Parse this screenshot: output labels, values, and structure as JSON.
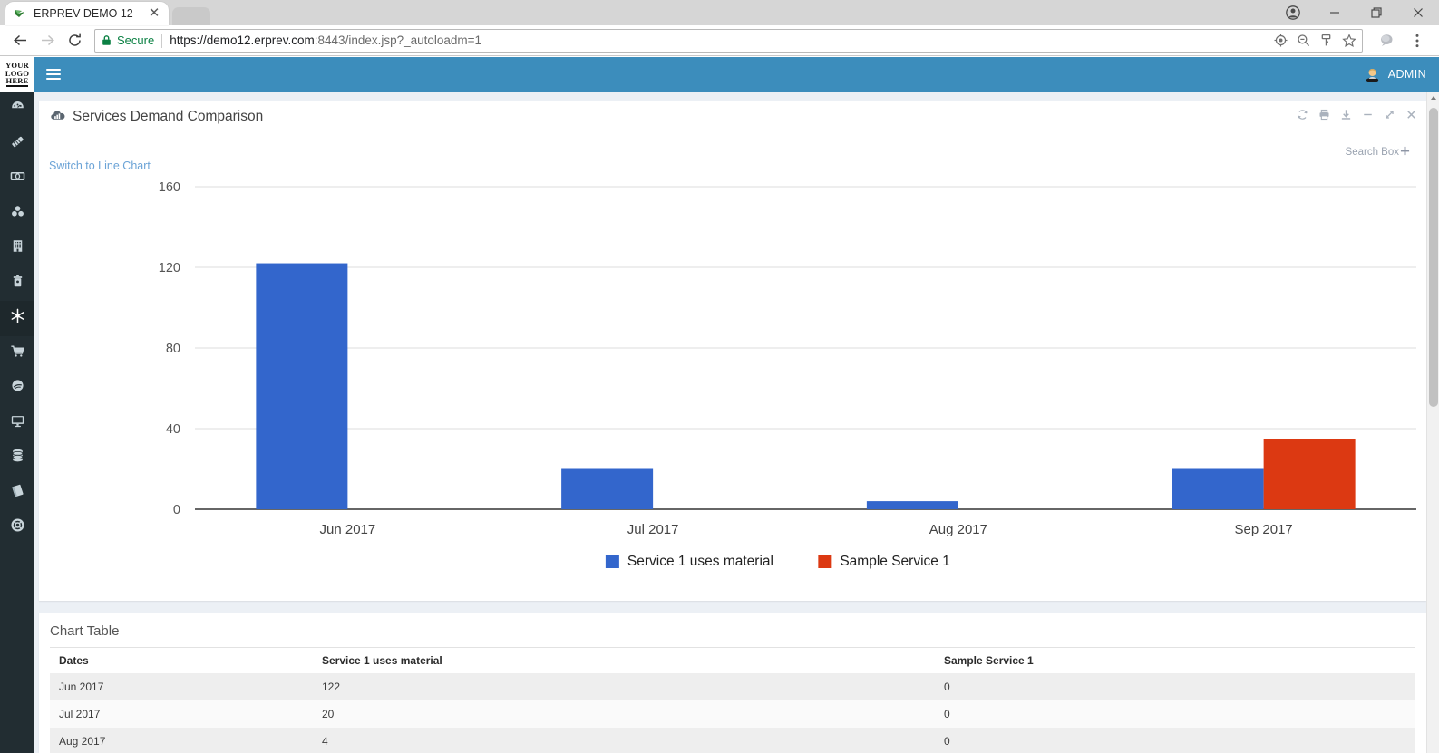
{
  "browser": {
    "tab_title": "ERPREV DEMO 12",
    "close_tab_glyph": "✕",
    "secure_label": "Secure",
    "url_main": "https://demo12.erprev.com",
    "url_port": ":8443",
    "url_path": "/index.jsp?_autoloadm=1",
    "icons": {
      "back": "back-arrow-icon",
      "forward": "forward-arrow-icon",
      "reload": "reload-icon",
      "lock": "lock-icon",
      "location": "location-target-icon",
      "zoom_out": "zoom-out-icon",
      "key": "key-icon",
      "bookmark": "star-icon",
      "extension": "extension-icon",
      "menu": "three-dot-menu-icon",
      "profile": "profile-icon",
      "minimize": "minimize-icon",
      "maximize": "maximize-icon",
      "close": "close-icon"
    }
  },
  "app": {
    "logo_line1": "YOUR",
    "logo_line2": "LOGO",
    "logo_line3": "HERE",
    "user_label": "ADMIN",
    "sidebar": [
      {
        "name": "dashboard",
        "icon": "gauge-icon"
      },
      {
        "name": "tickets",
        "icon": "tag-icon"
      },
      {
        "name": "finance",
        "icon": "money-icon"
      },
      {
        "name": "inventory",
        "icon": "cubes-icon"
      },
      {
        "name": "building",
        "icon": "building-icon"
      },
      {
        "name": "trash",
        "icon": "trash-icon"
      },
      {
        "name": "services",
        "icon": "snowflake-icon"
      },
      {
        "name": "sales",
        "icon": "cart-icon"
      },
      {
        "name": "web",
        "icon": "globe-disc-icon"
      },
      {
        "name": "monitor",
        "icon": "monitor-icon"
      },
      {
        "name": "database",
        "icon": "database-icon"
      },
      {
        "name": "book",
        "icon": "book-icon"
      },
      {
        "name": "support",
        "icon": "lifering-icon"
      }
    ]
  },
  "panel": {
    "title": "Services Demand Comparison",
    "title_icon": "bar-chart-cloud-icon",
    "tools": [
      {
        "name": "refresh-button",
        "icon": "refresh-icon"
      },
      {
        "name": "print-button",
        "icon": "printer-icon"
      },
      {
        "name": "download-button",
        "icon": "download-icon"
      },
      {
        "name": "minimize-button",
        "icon": "minus-icon"
      },
      {
        "name": "expand-button",
        "icon": "expand-arrows-icon"
      },
      {
        "name": "close-button",
        "icon": "close-x-icon"
      }
    ],
    "search_box_label": "Search Box",
    "search_box_plus": "+",
    "switch_link": "Switch to Line Chart"
  },
  "chart_data": {
    "type": "bar",
    "title": "Services Demand Comparison",
    "xlabel": "",
    "ylabel": "",
    "categories": [
      "Jun 2017",
      "Jul 2017",
      "Aug 2017",
      "Sep 2017"
    ],
    "series": [
      {
        "name": "Service 1 uses material",
        "color": "#3366CC",
        "values": [
          122,
          20,
          4,
          20
        ]
      },
      {
        "name": "Sample Service 1",
        "color": "#DC3912",
        "values": [
          0,
          0,
          0,
          35
        ]
      }
    ],
    "ylim": [
      0,
      160
    ],
    "yticks": [
      0,
      40,
      80,
      120,
      160
    ],
    "grid": true,
    "legend_position": "bottom"
  },
  "table": {
    "title": "Chart Table",
    "columns": [
      "Dates",
      "Service 1 uses material",
      "Sample Service 1"
    ],
    "rows": [
      [
        "Jun 2017",
        "122",
        "0"
      ],
      [
        "Jul 2017",
        "20",
        "0"
      ],
      [
        "Aug 2017",
        "4",
        "0"
      ]
    ]
  }
}
